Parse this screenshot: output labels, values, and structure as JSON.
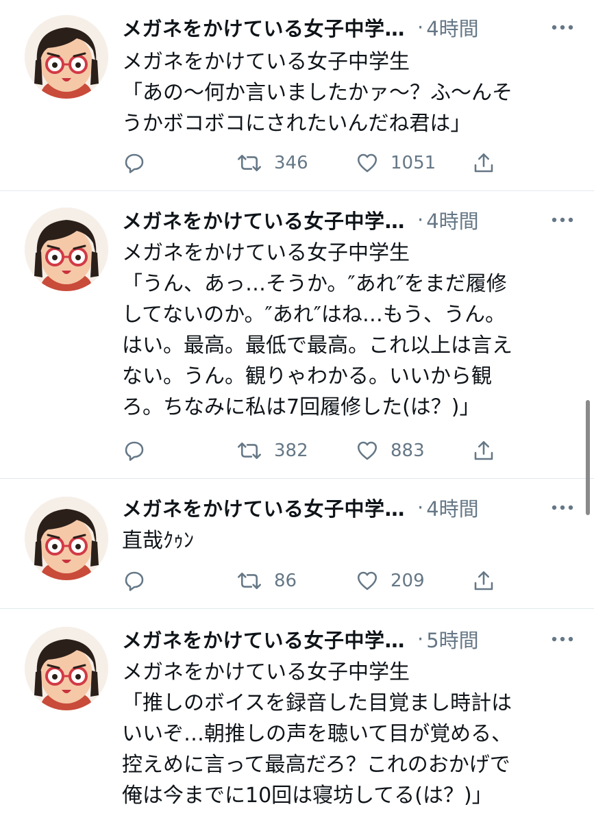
{
  "tweets": [
    {
      "name": "メガネをかけている女子中学…",
      "time": "4時間",
      "lines": [
        "メガネをかけている女子中学生",
        "「あの～何か言いましたかァ～？ふ～んそ",
        "うかボコボコにされたいんだね君は」"
      ],
      "retweets": "346",
      "likes": "1051"
    },
    {
      "name": "メガネをかけている女子中学…",
      "time": "4時間",
      "lines": [
        "メガネをかけている女子中学生",
        "「うん、あっ…そうか。″あれ″をまだ履修",
        "してないのか。″あれ″はね…もう、うん。",
        "はい。最高。最低で最高。これ以上は言え",
        "ない。うん。観りゃわかる。いいから観",
        "ろ。ちなみに私は7回履修した(は？)」"
      ],
      "retweets": "382",
      "likes": "883"
    },
    {
      "name": "メガネをかけている女子中学…",
      "time": "4時間",
      "lines": [
        "直哉ｸｩﾝ"
      ],
      "retweets": "86",
      "likes": "209"
    },
    {
      "name": "メガネをかけている女子中学…",
      "time": "5時間",
      "lines": [
        "メガネをかけている女子中学生",
        "「推しのボイスを録音した目覚まし時計は",
        "いいぞ…朝推しの声を聴いて目が覚める、",
        "控えめに言って最高だろ？これのおかげで",
        "俺は今までに10回は寝坊してる(は？)」"
      ]
    }
  ],
  "separator": "·",
  "icons": {
    "reply": "reply-icon",
    "retweet": "retweet-icon",
    "like": "heart-icon",
    "share": "share-icon",
    "more": "more-icon"
  },
  "colors": {
    "text": "#0f1419",
    "secondary": "#657786",
    "divider": "#e1e8ed"
  }
}
